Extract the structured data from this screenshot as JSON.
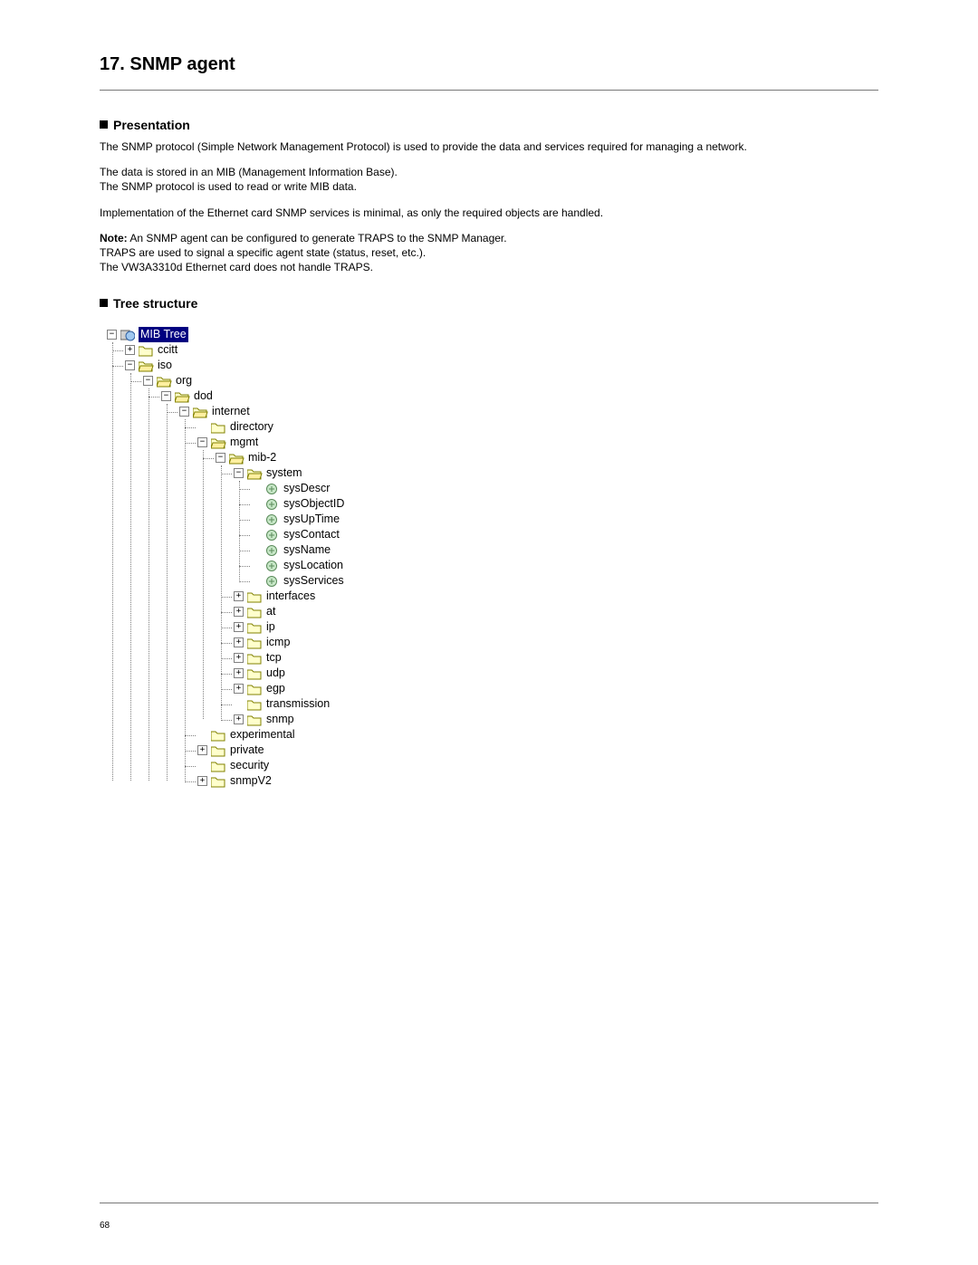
{
  "chapter_title": "17. SNMP agent",
  "page_number": "68",
  "sections": {
    "presentation": {
      "heading": "Presentation",
      "p1": "The SNMP protocol (Simple Network Management Protocol) is used to provide the data and services required for managing a network.",
      "p2": "The data is stored in an MIB (Management Information Base).",
      "p3": "The SNMP protocol is used to read or write MIB data.",
      "p4": "Implementation of the Ethernet card SNMP services is minimal, as only the required objects are handled.",
      "note_label": "Note:",
      "note1": " An SNMP agent can be configured to generate TRAPS to the SNMP Manager.",
      "note2": "TRAPS are used to signal a specific agent state (status, reset, etc.).",
      "note3": "The VW3A3310d Ethernet card does not handle TRAPS."
    },
    "tree_heading": "Tree structure"
  },
  "tree": {
    "root": "MIB Tree",
    "ccitt": "ccitt",
    "iso": "iso",
    "org": "org",
    "dod": "dod",
    "internet": "internet",
    "directory": "directory",
    "mgmt": "mgmt",
    "mib2": "mib-2",
    "system": "system",
    "sysDescr": "sysDescr",
    "sysObjectID": "sysObjectID",
    "sysUpTime": "sysUpTime",
    "sysContact": "sysContact",
    "sysName": "sysName",
    "sysLocation": "sysLocation",
    "sysServices": "sysServices",
    "interfaces": "interfaces",
    "at": "at",
    "ip": "ip",
    "icmp": "icmp",
    "tcp": "tcp",
    "udp": "udp",
    "egp": "egp",
    "transmission": "transmission",
    "snmp": "snmp",
    "experimental": "experimental",
    "private": "private",
    "security": "security",
    "snmpV2": "snmpV2"
  }
}
